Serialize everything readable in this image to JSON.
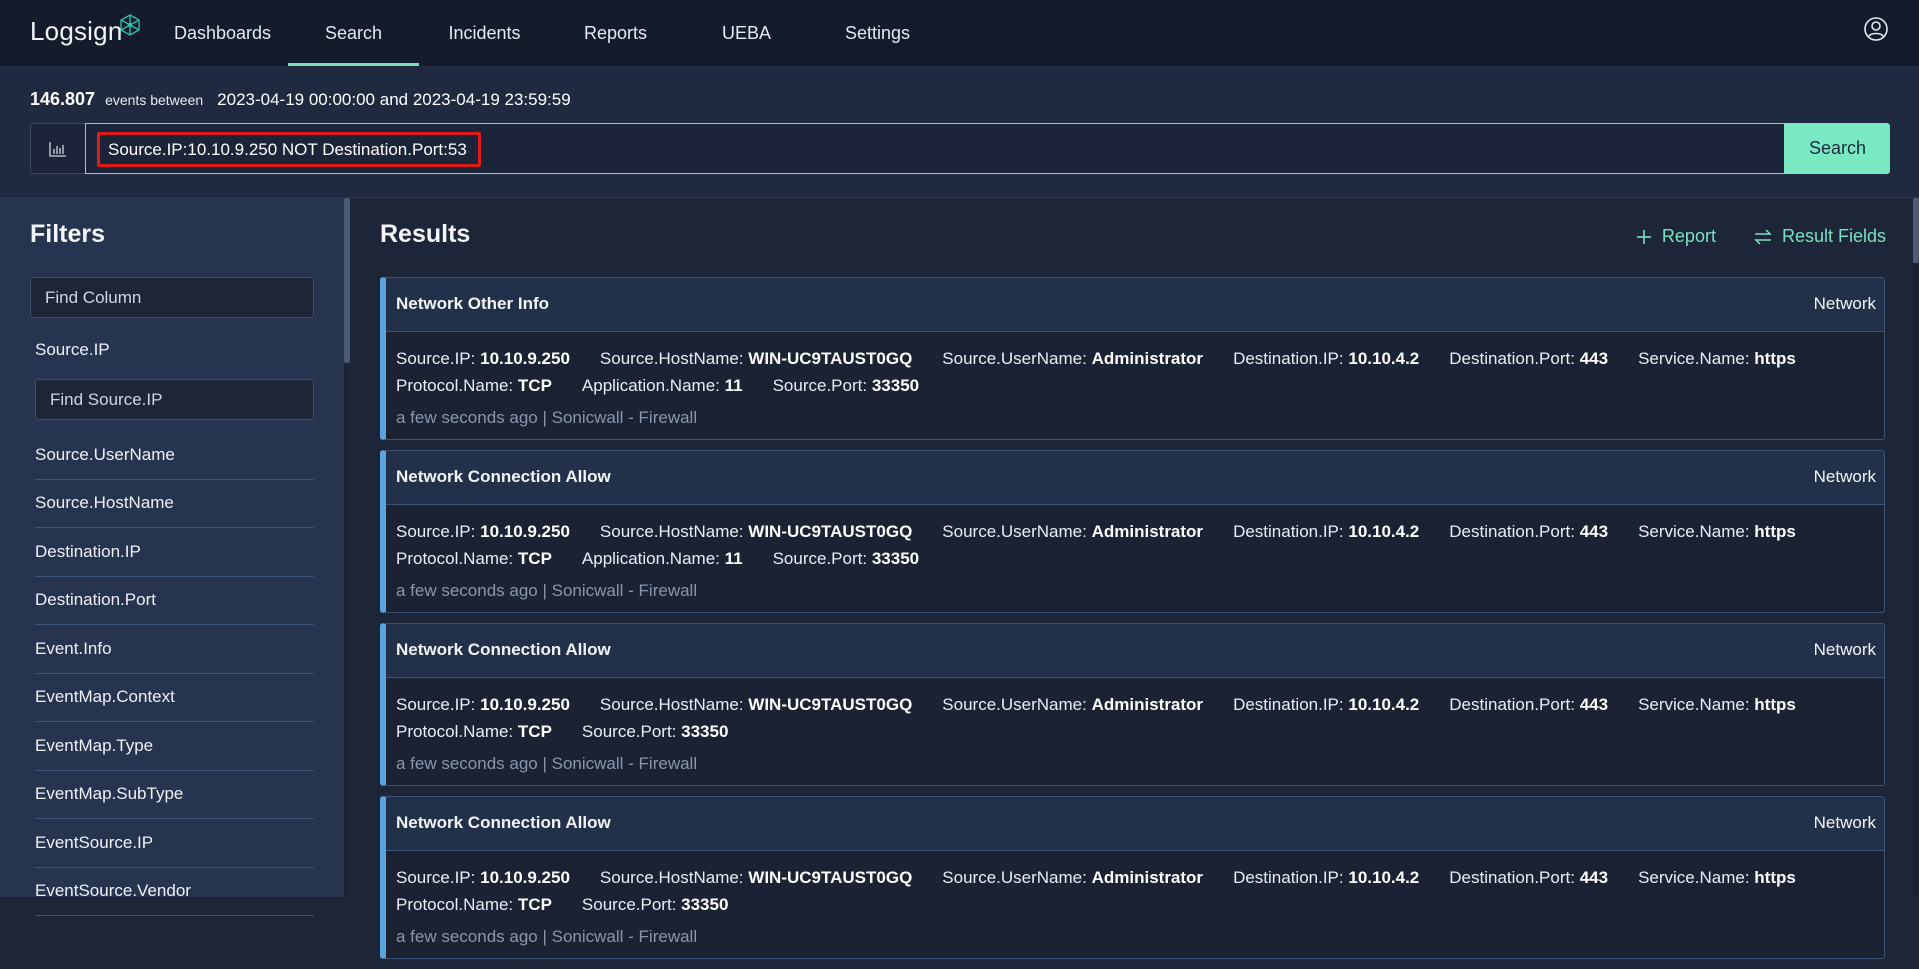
{
  "nav": {
    "logo_text": "Logsign",
    "items": [
      {
        "label": "Dashboards",
        "active": false
      },
      {
        "label": "Search",
        "active": true
      },
      {
        "label": "Incidents",
        "active": false
      },
      {
        "label": "Reports",
        "active": false
      },
      {
        "label": "UEBA",
        "active": false
      },
      {
        "label": "Settings",
        "active": false
      }
    ],
    "user_icon": "user-circle-icon"
  },
  "search": {
    "event_count": "146.807",
    "events_between_label": "events between",
    "date_range": "2023-04-19 00:00:00 and 2023-04-19 23:59:59",
    "query": "Source.IP:10.10.9.250 NOT Destination.Port:53",
    "search_button": "Search",
    "chart_icon": "bar-chart-icon",
    "highlight_color": "#e01919"
  },
  "filters": {
    "title": "Filters",
    "find_column_placeholder": "Find Column",
    "selected_field": "Source.IP",
    "find_field_placeholder": "Find Source.IP",
    "fields": [
      "Source.UserName",
      "Source.HostName",
      "Destination.IP",
      "Destination.Port",
      "Event.Info",
      "EventMap.Context",
      "EventMap.Type",
      "EventMap.SubType",
      "EventSource.IP",
      "EventSource.Vendor"
    ]
  },
  "results": {
    "title": "Results",
    "report_label": "Report",
    "result_fields_label": "Result Fields",
    "accent_color": "#79e1c0",
    "cards": [
      {
        "title": "Network Other Info",
        "category": "Network",
        "lines": [
          [
            {
              "k": "Source.IP:",
              "v": "10.10.9.250"
            },
            {
              "k": "Source.HostName:",
              "v": "WIN-UC9TAUST0GQ"
            },
            {
              "k": "Source.UserName:",
              "v": "Administrator"
            },
            {
              "k": "Destination.IP:",
              "v": "10.10.4.2"
            },
            {
              "k": "Destination.Port:",
              "v": "443"
            },
            {
              "k": "Service.Name:",
              "v": "https"
            }
          ],
          [
            {
              "k": "Protocol.Name:",
              "v": "TCP"
            },
            {
              "k": "Application.Name:",
              "v": "11"
            },
            {
              "k": "Source.Port:",
              "v": "33350"
            }
          ]
        ],
        "meta": "a few seconds ago | Sonicwall - Firewall"
      },
      {
        "title": "Network Connection Allow",
        "category": "Network",
        "lines": [
          [
            {
              "k": "Source.IP:",
              "v": "10.10.9.250"
            },
            {
              "k": "Source.HostName:",
              "v": "WIN-UC9TAUST0GQ"
            },
            {
              "k": "Source.UserName:",
              "v": "Administrator"
            },
            {
              "k": "Destination.IP:",
              "v": "10.10.4.2"
            },
            {
              "k": "Destination.Port:",
              "v": "443"
            },
            {
              "k": "Service.Name:",
              "v": "https"
            }
          ],
          [
            {
              "k": "Protocol.Name:",
              "v": "TCP"
            },
            {
              "k": "Application.Name:",
              "v": "11"
            },
            {
              "k": "Source.Port:",
              "v": "33350"
            }
          ]
        ],
        "meta": "a few seconds ago | Sonicwall - Firewall"
      },
      {
        "title": "Network Connection Allow",
        "category": "Network",
        "lines": [
          [
            {
              "k": "Source.IP:",
              "v": "10.10.9.250"
            },
            {
              "k": "Source.HostName:",
              "v": "WIN-UC9TAUST0GQ"
            },
            {
              "k": "Source.UserName:",
              "v": "Administrator"
            },
            {
              "k": "Destination.IP:",
              "v": "10.10.4.2"
            },
            {
              "k": "Destination.Port:",
              "v": "443"
            },
            {
              "k": "Service.Name:",
              "v": "https"
            }
          ],
          [
            {
              "k": "Protocol.Name:",
              "v": "TCP"
            },
            {
              "k": "Source.Port:",
              "v": "33350"
            }
          ]
        ],
        "meta": "a few seconds ago | Sonicwall - Firewall"
      },
      {
        "title": "Network Connection Allow",
        "category": "Network",
        "lines": [
          [
            {
              "k": "Source.IP:",
              "v": "10.10.9.250"
            },
            {
              "k": "Source.HostName:",
              "v": "WIN-UC9TAUST0GQ"
            },
            {
              "k": "Source.UserName:",
              "v": "Administrator"
            },
            {
              "k": "Destination.IP:",
              "v": "10.10.4.2"
            },
            {
              "k": "Destination.Port:",
              "v": "443"
            },
            {
              "k": "Service.Name:",
              "v": "https"
            }
          ],
          [
            {
              "k": "Protocol.Name:",
              "v": "TCP"
            },
            {
              "k": "Source.Port:",
              "v": "33350"
            }
          ]
        ],
        "meta": "a few seconds ago | Sonicwall - Firewall"
      }
    ]
  }
}
